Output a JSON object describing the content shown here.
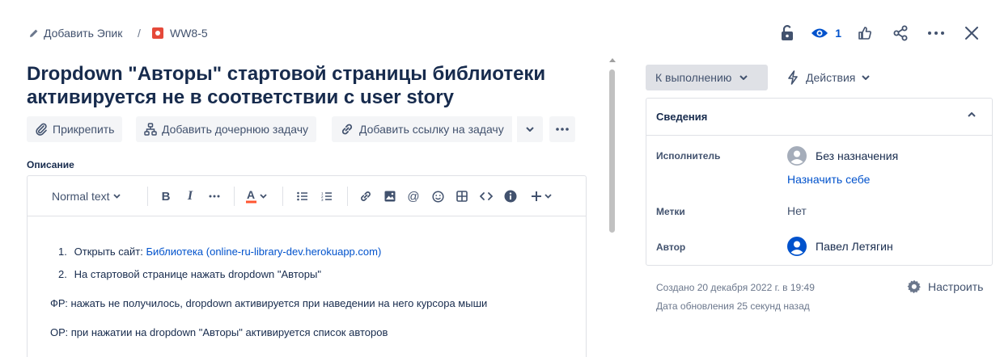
{
  "breadcrumb": {
    "add_epic": "Добавить Эпик",
    "separator": "/",
    "issue_key": "WW8-5"
  },
  "header": {
    "watch_count": "1",
    "icons": [
      "lock-icon",
      "eye-icon",
      "thumbs-up-icon",
      "share-icon",
      "more-icon",
      "close-icon"
    ]
  },
  "issue": {
    "title": "Dropdown \"Авторы\" стартовой страницы библиотеки активируется не в соответствии с user story"
  },
  "actions": {
    "attach": "Прикрепить",
    "add_child": "Добавить дочернюю задачу",
    "add_link": "Добавить ссылку на задачу"
  },
  "description": {
    "label": "Описание",
    "toolbar": {
      "text_style": "Normal text"
    },
    "steps": [
      {
        "num": "1.",
        "text": "Открыть сайт: ",
        "link": "Библиотека (online-ru-library-dev.herokuapp.com)"
      },
      {
        "num": "2.",
        "text": "На стартовой странице нажать dropdown \"Авторы\""
      }
    ],
    "actual": "ФР: нажать не получилось, dropdown активируется при наведении на него курсора мыши",
    "expected": "ОР: при нажатии на dropdown \"Авторы\" активируется список авторов"
  },
  "sidebar": {
    "status": "К выполнению",
    "actions": "Действия",
    "details": {
      "title": "Сведения",
      "assignee_label": "Исполнитель",
      "assignee_value": "Без назначения",
      "assign_self": "Назначить себе",
      "labels_label": "Метки",
      "labels_value": "Нет",
      "reporter_label": "Автор",
      "reporter_value": "Павел Летягин"
    },
    "created": "Создано 20 декабря 2022 г. в 19:49",
    "updated": "Дата обновления 25 секунд назад",
    "configure": "Настроить"
  },
  "colors": {
    "link": "#0052cc",
    "text": "#172b4d",
    "muted": "#42526e",
    "bug": "#e5493a",
    "button_bg": "#f4f5f7"
  }
}
